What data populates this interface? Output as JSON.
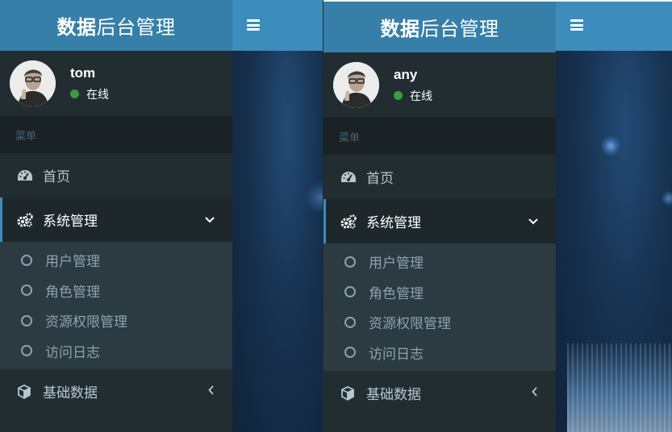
{
  "panels": [
    {
      "logo": {
        "bold": "数据",
        "rest": "后台管理"
      },
      "user": {
        "name": "tom",
        "status": "在线"
      },
      "menu_header": "菜单",
      "items": [
        {
          "label": "首页",
          "icon": "dashboard-icon"
        },
        {
          "label": "系统管理",
          "icon": "cogs-icon",
          "arrow": "chevron-down-icon",
          "active": true
        },
        {
          "label": "基础数据",
          "icon": "cube-icon",
          "arrow": "chevron-left-icon"
        }
      ],
      "submenu": [
        "用户管理",
        "角色管理",
        "资源权限管理",
        "访问日志"
      ]
    },
    {
      "logo": {
        "bold": "数据",
        "rest": "后台管理"
      },
      "user": {
        "name": "any",
        "status": "在线"
      },
      "menu_header": "菜单",
      "items": [
        {
          "label": "首页",
          "icon": "dashboard-icon"
        },
        {
          "label": "系统管理",
          "icon": "cogs-icon",
          "arrow": "chevron-down-icon",
          "active": true
        },
        {
          "label": "基础数据",
          "icon": "cube-icon",
          "arrow": "chevron-left-icon"
        }
      ],
      "submenu": [
        "用户管理",
        "角色管理",
        "资源权限管理",
        "访问日志"
      ]
    }
  ],
  "colors": {
    "logo_bg": "#367fa9",
    "navbar_bg": "#3c8dbc",
    "sidebar_bg": "#222d32",
    "online": "#3c9b40"
  }
}
